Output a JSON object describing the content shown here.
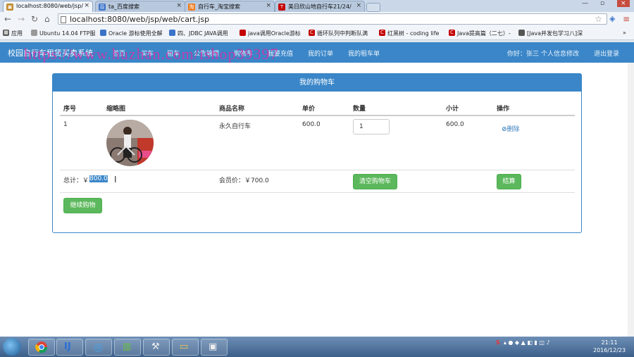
{
  "browser": {
    "tabs": [
      {
        "label": "localhost:8080/web/jsp/"
      },
      {
        "label": "ta_百度搜索"
      },
      {
        "label": "自行车_淘宝搜索"
      },
      {
        "label": "美日欣山地自行车21/24/"
      }
    ],
    "url": "localhost:8080/web/jsp/web/cart.jsp",
    "bookmarks": [
      {
        "label": "应用"
      },
      {
        "label": "Ubuntu 14.04 FTP服"
      },
      {
        "label": "Oracle 游标使用全解"
      },
      {
        "label": "四、JDBC JAVA调用"
      },
      {
        "label": "java调用Oracle游标"
      },
      {
        "label": "循环队列中判断队满"
      },
      {
        "label": "红黑树 - coding life"
      },
      {
        "label": "Java提高篇（二七）-"
      },
      {
        "label": "[Java并发包学习八]深"
      }
    ],
    "more": "»"
  },
  "nav": {
    "brand": "校园自行车租赁买卖系统",
    "items": [
      "首页",
      "买车",
      "租车",
      "公告管理",
      "购物车",
      "我要充值",
      "我的订单",
      "我的租车单"
    ],
    "greeting": "你好：张三",
    "profile": "个人信息修改",
    "logout": "退出登录"
  },
  "watermark": "https://www.huzhan.com/ishop39397",
  "cart": {
    "title": "我的购物车",
    "headers": [
      "序号",
      "缩略图",
      "商品名称",
      "单价",
      "数量",
      "小计",
      "操作"
    ],
    "item": {
      "index": "1",
      "name": "永久自行车",
      "price": "600.0",
      "qty": "1",
      "subtotal": "600.0",
      "delete": "删除"
    },
    "total_label": "总计：￥",
    "total_value": "800.0",
    "member_label": "会员价：￥700.0",
    "clear": "清空购物车",
    "checkout": "结算",
    "continue": "继续购物"
  },
  "taskbar": {
    "time": "21:11",
    "date": "2016/12/23"
  }
}
